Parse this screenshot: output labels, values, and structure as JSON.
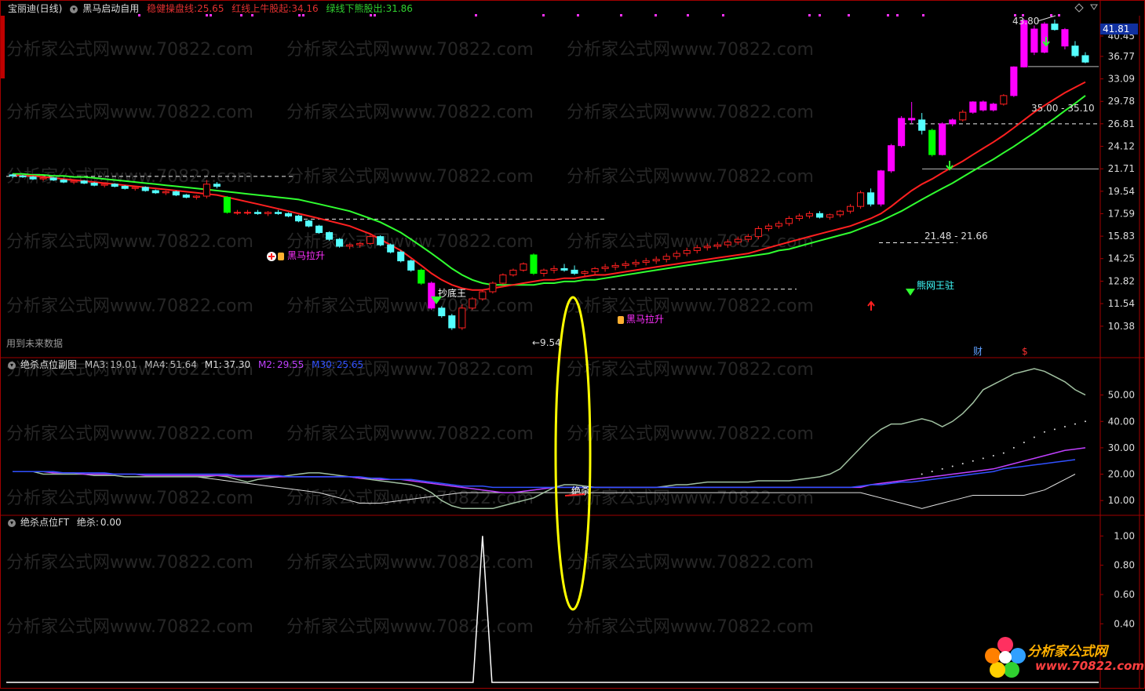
{
  "header_main": {
    "stock": "宝丽迪(日线)",
    "indicator": "黑马启动自用",
    "label_a": "稳健操盘线:",
    "value_a": "25.65",
    "label_b": "红线上牛股起:",
    "value_b": "34.16",
    "label_c": "绿线下熊股出:",
    "value_c": "31.86",
    "color_a": "#e03030",
    "color_b": "#e03030",
    "color_c": "#30d030"
  },
  "header_sub1": {
    "name": "绝杀点位副图",
    "ma3_label": "MA3:",
    "ma3": "19.01",
    "ma4_label": "MA4:",
    "ma4": "51.64",
    "m1_label": "M1:",
    "m1": "37.30",
    "m2_label": "M2:",
    "m2": "29.55",
    "m30_label": "M30:",
    "m30": "25.65"
  },
  "header_sub2": {
    "name": "绝杀点位FT",
    "label": "绝杀:",
    "value": "0.00"
  },
  "annotations": {
    "future_data": "用到未来数据",
    "high_label": "43.80",
    "low_label": "9.54",
    "price_current": "41.81",
    "range_upper": "35.00 - 35.10",
    "range_lower": "21.48 - 21.66",
    "chaodi": "抄底王",
    "heima1": "黑马拉升",
    "heima2": "黑马拉升",
    "wangwang": "熊网王驻",
    "cai": "财",
    "dollar": "$",
    "juesha": "绝杀"
  },
  "watermark": "分析家公式网www.70822.com",
  "logo": {
    "title": "分析家公式网",
    "url": "www.70822.com"
  },
  "axis_main": [
    "40.45",
    "36.77",
    "33.09",
    "29.78",
    "26.81",
    "24.12",
    "21.71",
    "19.54",
    "17.59",
    "15.83",
    "14.25",
    "12.82",
    "11.54",
    "10.38"
  ],
  "axis_sub1": [
    "50.00",
    "40.00",
    "30.00",
    "20.00",
    "10.00"
  ],
  "axis_sub2": [
    "1.00",
    "0.80",
    "0.60",
    "0.40"
  ],
  "chart_data": {
    "type": "candlestick",
    "ylim_main": [
      9.5,
      44.5
    ],
    "candles": [
      [
        21.1,
        21.2,
        20.8,
        21.0
      ],
      [
        21.0,
        21.1,
        20.8,
        20.9
      ],
      [
        20.9,
        21.0,
        20.6,
        20.7
      ],
      [
        20.7,
        20.9,
        20.5,
        20.8
      ],
      [
        20.8,
        20.9,
        20.5,
        20.6
      ],
      [
        20.6,
        20.7,
        20.3,
        20.4
      ],
      [
        20.4,
        20.6,
        20.2,
        20.5
      ],
      [
        20.5,
        20.6,
        20.2,
        20.3
      ],
      [
        20.3,
        20.4,
        20.0,
        20.1
      ],
      [
        20.1,
        20.3,
        19.9,
        20.2
      ],
      [
        20.2,
        20.3,
        19.9,
        20.0
      ],
      [
        20.0,
        20.1,
        19.7,
        19.8
      ],
      [
        19.8,
        20.0,
        19.6,
        19.9
      ],
      [
        19.9,
        20.0,
        19.5,
        19.6
      ],
      [
        19.6,
        19.7,
        19.3,
        19.4
      ],
      [
        19.4,
        19.6,
        19.2,
        19.5
      ],
      [
        19.5,
        19.6,
        19.1,
        19.2
      ],
      [
        19.2,
        19.3,
        18.9,
        19.0
      ],
      [
        19.0,
        19.2,
        18.8,
        19.1
      ],
      [
        19.1,
        20.6,
        18.9,
        20.2
      ],
      [
        20.2,
        20.4,
        19.8,
        20.0
      ],
      [
        19.0,
        19.1,
        17.6,
        17.7
      ],
      [
        17.7,
        17.9,
        17.5,
        17.7
      ],
      [
        17.7,
        17.9,
        17.5,
        17.7
      ],
      [
        17.7,
        17.9,
        17.5,
        17.6
      ],
      [
        17.6,
        17.8,
        17.4,
        17.7
      ],
      [
        17.7,
        17.9,
        17.5,
        17.6
      ],
      [
        17.6,
        17.7,
        17.3,
        17.4
      ],
      [
        17.4,
        17.5,
        16.9,
        17.0
      ],
      [
        17.0,
        17.1,
        16.5,
        16.6
      ],
      [
        16.6,
        16.7,
        16.0,
        16.1
      ],
      [
        16.1,
        16.2,
        15.5,
        15.6
      ],
      [
        15.6,
        15.7,
        15.0,
        15.1
      ],
      [
        15.1,
        15.3,
        14.9,
        15.2
      ],
      [
        15.2,
        15.4,
        15.0,
        15.3
      ],
      [
        15.3,
        15.9,
        15.2,
        15.8
      ],
      [
        15.8,
        15.9,
        15.1,
        15.2
      ],
      [
        15.2,
        15.3,
        14.6,
        14.7
      ],
      [
        14.7,
        14.8,
        14.0,
        14.1
      ],
      [
        14.1,
        14.2,
        13.4,
        13.5
      ],
      [
        13.5,
        13.6,
        12.6,
        12.7
      ],
      [
        12.7,
        12.8,
        11.2,
        11.3
      ],
      [
        11.3,
        11.4,
        10.8,
        10.9
      ],
      [
        10.9,
        11.0,
        10.2,
        10.3
      ],
      [
        10.3,
        11.5,
        10.2,
        11.3
      ],
      [
        11.3,
        11.9,
        11.2,
        11.8
      ],
      [
        11.8,
        12.3,
        11.7,
        12.2
      ],
      [
        12.2,
        12.8,
        12.1,
        12.7
      ],
      [
        12.7,
        13.3,
        12.6,
        13.2
      ],
      [
        13.2,
        13.6,
        13.1,
        13.5
      ],
      [
        13.5,
        14.0,
        13.4,
        13.9
      ],
      [
        14.5,
        14.6,
        13.2,
        13.3
      ],
      [
        13.3,
        13.6,
        13.1,
        13.5
      ],
      [
        13.5,
        13.8,
        13.3,
        13.6
      ],
      [
        13.6,
        13.9,
        13.4,
        13.5
      ],
      [
        13.5,
        13.8,
        13.2,
        13.3
      ],
      [
        13.3,
        13.5,
        13.1,
        13.4
      ],
      [
        13.4,
        13.7,
        13.2,
        13.6
      ],
      [
        13.6,
        13.9,
        13.4,
        13.7
      ],
      [
        13.7,
        14.0,
        13.5,
        13.8
      ],
      [
        13.8,
        14.1,
        13.6,
        13.9
      ],
      [
        13.9,
        14.2,
        13.7,
        14.0
      ],
      [
        14.0,
        14.3,
        13.8,
        14.1
      ],
      [
        14.1,
        14.4,
        13.9,
        14.2
      ],
      [
        14.2,
        14.6,
        14.0,
        14.4
      ],
      [
        14.4,
        14.8,
        14.2,
        14.6
      ],
      [
        14.6,
        15.0,
        14.4,
        14.8
      ],
      [
        14.8,
        15.2,
        14.6,
        15.0
      ],
      [
        15.0,
        15.3,
        14.8,
        15.1
      ],
      [
        15.1,
        15.4,
        14.9,
        15.2
      ],
      [
        15.2,
        15.6,
        15.0,
        15.4
      ],
      [
        15.4,
        15.8,
        15.2,
        15.6
      ],
      [
        15.6,
        16.0,
        15.4,
        15.8
      ],
      [
        15.8,
        16.6,
        15.6,
        16.4
      ],
      [
        16.4,
        16.8,
        16.2,
        16.6
      ],
      [
        16.6,
        17.0,
        16.4,
        16.8
      ],
      [
        16.8,
        17.4,
        16.6,
        17.2
      ],
      [
        17.2,
        17.6,
        17.0,
        17.4
      ],
      [
        17.4,
        17.8,
        17.2,
        17.6
      ],
      [
        17.6,
        17.8,
        17.2,
        17.3
      ],
      [
        17.3,
        17.6,
        17.1,
        17.5
      ],
      [
        17.5,
        17.9,
        17.3,
        17.8
      ],
      [
        17.8,
        18.4,
        17.6,
        18.2
      ],
      [
        18.2,
        19.6,
        18.0,
        19.4
      ],
      [
        19.4,
        19.8,
        18.2,
        18.4
      ],
      [
        18.4,
        21.6,
        18.2,
        21.5
      ],
      [
        21.5,
        24.4,
        21.3,
        24.2
      ],
      [
        24.2,
        27.8,
        24.0,
        27.5
      ],
      [
        27.5,
        29.7,
        26.9,
        27.3
      ],
      [
        27.3,
        28.2,
        25.5,
        26.0
      ],
      [
        26.0,
        26.2,
        23.0,
        23.2
      ],
      [
        23.2,
        27.0,
        23.1,
        26.8
      ],
      [
        26.8,
        27.5,
        26.5,
        27.3
      ],
      [
        27.3,
        28.6,
        27.1,
        28.3
      ],
      [
        28.3,
        29.8,
        28.1,
        29.7
      ],
      [
        29.7,
        29.9,
        28.4,
        28.6
      ],
      [
        28.6,
        29.6,
        28.4,
        29.4
      ],
      [
        29.4,
        30.8,
        29.2,
        30.6
      ],
      [
        30.6,
        35.1,
        30.4,
        35.0
      ],
      [
        35.0,
        43.8,
        34.9,
        43.5
      ],
      [
        41.8,
        42.5,
        37.0,
        37.5
      ],
      [
        37.5,
        43.2,
        37.3,
        42.8
      ],
      [
        42.8,
        43.7,
        41.5,
        41.7
      ],
      [
        41.7,
        42.0,
        38.0,
        38.6
      ],
      [
        38.6,
        39.5,
        36.6,
        36.9
      ],
      [
        36.9,
        37.5,
        35.6,
        35.8
      ]
    ],
    "ma_red": [
      21.1,
      21.0,
      21.0,
      20.9,
      20.8,
      20.7,
      20.6,
      20.5,
      20.4,
      20.3,
      20.2,
      20.1,
      20.0,
      19.9,
      19.8,
      19.7,
      19.6,
      19.5,
      19.4,
      19.3,
      19.2,
      19.0,
      18.8,
      18.6,
      18.4,
      18.2,
      18.0,
      17.8,
      17.6,
      17.4,
      17.2,
      17.0,
      16.8,
      16.6,
      16.3,
      16.0,
      15.6,
      15.2,
      14.8,
      14.3,
      13.8,
      13.3,
      12.9,
      12.6,
      12.4,
      12.3,
      12.3,
      12.4,
      12.5,
      12.6,
      12.7,
      12.8,
      12.9,
      12.9,
      13.0,
      13.0,
      13.1,
      13.2,
      13.2,
      13.3,
      13.4,
      13.5,
      13.6,
      13.7,
      13.8,
      13.9,
      14.0,
      14.1,
      14.2,
      14.3,
      14.4,
      14.5,
      14.6,
      14.8,
      15.0,
      15.2,
      15.4,
      15.6,
      15.8,
      16.0,
      16.2,
      16.4,
      16.6,
      16.9,
      17.2,
      17.6,
      18.2,
      18.9,
      19.6,
      20.2,
      20.7,
      21.3,
      21.9,
      22.5,
      23.2,
      23.9,
      24.6,
      25.4,
      26.3,
      27.3,
      28.3,
      29.2,
      30.1,
      31.0,
      31.8,
      32.6
    ],
    "ma_green": [
      21.2,
      21.2,
      21.1,
      21.1,
      21.0,
      21.0,
      20.9,
      20.9,
      20.8,
      20.7,
      20.6,
      20.5,
      20.4,
      20.3,
      20.2,
      20.1,
      20.0,
      19.9,
      19.8,
      19.7,
      19.6,
      19.5,
      19.4,
      19.3,
      19.2,
      19.1,
      19.0,
      18.9,
      18.8,
      18.6,
      18.4,
      18.2,
      18.0,
      17.8,
      17.5,
      17.2,
      16.9,
      16.5,
      16.1,
      15.6,
      15.1,
      14.6,
      14.1,
      13.6,
      13.2,
      12.9,
      12.7,
      12.6,
      12.6,
      12.6,
      12.6,
      12.6,
      12.7,
      12.7,
      12.8,
      12.8,
      12.9,
      12.9,
      13.0,
      13.1,
      13.2,
      13.3,
      13.4,
      13.5,
      13.6,
      13.7,
      13.8,
      13.9,
      14.0,
      14.1,
      14.2,
      14.3,
      14.4,
      14.5,
      14.6,
      14.8,
      14.9,
      15.1,
      15.3,
      15.5,
      15.7,
      15.9,
      16.1,
      16.4,
      16.7,
      17.0,
      17.4,
      17.8,
      18.3,
      18.8,
      19.3,
      19.8,
      20.3,
      20.9,
      21.5,
      22.1,
      22.7,
      23.4,
      24.1,
      24.9,
      25.7,
      26.6,
      27.5,
      28.5,
      29.5,
      30.6
    ],
    "sub1_ylim": [
      5,
      60
    ],
    "sub1_white": [
      21,
      21,
      21,
      20,
      20,
      20,
      20,
      20,
      19.5,
      19.5,
      19.5,
      19,
      19,
      19,
      19,
      19,
      19,
      19,
      19,
      19,
      19.5,
      19,
      18,
      17,
      18,
      18.5,
      19,
      19.5,
      20,
      20.5,
      20.5,
      20,
      19.5,
      19,
      18.5,
      18,
      17.5,
      17,
      16.5,
      16,
      15,
      13,
      10,
      8,
      7,
      7,
      7,
      7,
      8,
      9,
      10,
      11,
      13,
      15,
      16,
      16,
      15.5,
      15,
      15,
      15,
      15,
      15,
      15,
      15,
      15.5,
      16,
      16,
      16.5,
      17,
      17,
      17,
      17,
      17,
      17.5,
      17.5,
      17.5,
      17.5,
      18,
      18.5,
      19,
      20,
      22,
      26,
      30,
      34,
      37,
      39,
      39,
      40,
      41,
      40,
      38,
      40,
      43,
      47,
      52,
      54,
      56,
      58,
      59,
      60,
      59,
      57,
      55,
      52,
      50
    ],
    "sub1_gray": [
      21,
      21,
      21,
      20,
      20,
      20,
      20,
      20,
      19.5,
      19.5,
      19.5,
      19,
      19,
      19,
      19,
      19,
      19,
      19,
      19,
      18.5,
      18,
      17.5,
      17,
      16.5,
      16,
      15.5,
      15,
      14.5,
      14,
      13.5,
      13,
      12,
      11,
      10,
      9,
      9,
      9,
      9.5,
      10,
      10.5,
      11,
      11.5,
      12,
      12.5,
      13,
      13,
      13,
      13,
      13,
      13,
      13,
      13,
      13,
      13,
      13,
      13,
      13,
      13,
      13,
      13,
      13,
      13,
      13,
      13,
      13,
      13,
      13,
      13,
      13,
      13,
      13,
      13,
      13,
      13,
      13,
      13,
      13,
      13,
      13,
      13,
      13,
      13,
      13,
      13,
      12,
      11,
      10,
      9,
      8,
      7,
      8,
      9,
      10,
      11,
      12,
      12,
      12,
      12,
      12,
      12,
      13,
      14,
      16,
      18,
      20
    ],
    "sub1_purple": [
      21,
      21,
      21,
      21,
      20.5,
      20.5,
      20.5,
      20,
      20,
      20,
      20,
      20,
      20,
      19.5,
      19.5,
      19.5,
      19.5,
      19.5,
      19.5,
      19.5,
      19.5,
      19.5,
      19,
      19,
      19,
      19,
      19,
      19,
      19,
      19,
      19,
      19,
      19,
      19,
      18.5,
      18.5,
      18,
      18,
      18,
      17.5,
      17,
      16.5,
      16,
      15.5,
      15,
      14.5,
      14,
      13.5,
      13,
      13,
      13.5,
      14,
      14.5,
      15,
      15,
      15,
      15,
      15,
      15,
      15,
      15,
      15,
      15,
      15,
      15,
      15,
      15,
      15,
      15,
      15,
      15,
      15,
      15,
      15,
      15,
      15,
      15,
      15,
      15,
      15,
      15,
      15,
      15,
      15,
      16,
      16.5,
      17,
      17.5,
      18,
      18.5,
      19,
      19.5,
      20,
      20.5,
      21,
      21.5,
      22,
      23,
      24,
      25,
      26,
      27,
      28,
      29,
      29.5,
      30
    ],
    "sub1_blue": [
      21,
      21,
      21,
      21,
      21,
      20.5,
      20.5,
      20.5,
      20.5,
      20.5,
      20,
      20,
      20,
      20,
      20,
      20,
      20,
      20,
      20,
      20,
      20,
      20,
      19.5,
      19.5,
      19.5,
      19.5,
      19.5,
      19,
      19,
      19,
      19,
      19,
      19,
      19,
      19,
      18.5,
      18.5,
      18,
      18,
      18,
      17.5,
      17,
      16.5,
      16,
      15.5,
      15.5,
      15.5,
      15,
      15,
      15,
      15,
      15,
      15,
      15,
      15,
      15,
      15,
      15,
      15,
      15,
      15,
      15,
      15,
      15,
      15,
      15,
      15,
      15,
      15,
      15,
      15,
      15,
      15,
      15,
      15,
      15,
      15,
      15,
      15,
      15,
      15,
      15,
      15,
      15.5,
      16,
      16,
      16.5,
      17,
      17,
      17.5,
      18,
      18.5,
      19,
      19.5,
      20,
      20.5,
      21,
      22,
      22.5,
      23,
      23.5,
      24,
      24.5,
      25,
      25.5
    ],
    "sub1_dots": [
      null,
      null,
      null,
      null,
      null,
      null,
      null,
      null,
      null,
      null,
      null,
      null,
      null,
      null,
      null,
      null,
      null,
      null,
      null,
      null,
      null,
      null,
      null,
      null,
      null,
      null,
      null,
      null,
      null,
      null,
      null,
      null,
      null,
      null,
      null,
      null,
      null,
      null,
      null,
      null,
      null,
      null,
      null,
      null,
      null,
      null,
      null,
      null,
      null,
      null,
      null,
      null,
      null,
      null,
      null,
      null,
      null,
      null,
      null,
      null,
      null,
      null,
      null,
      null,
      null,
      null,
      null,
      null,
      null,
      null,
      null,
      null,
      null,
      null,
      null,
      null,
      null,
      null,
      null,
      null,
      null,
      null,
      null,
      null,
      null,
      null,
      null,
      null,
      null,
      20,
      21,
      22,
      23,
      24,
      25,
      26,
      27,
      28,
      30,
      32,
      34,
      36,
      37,
      38,
      39,
      40
    ],
    "sub2_spike_index": 46,
    "sub2_values_note": "单峰 1.00"
  },
  "colors": {
    "up": "#ff2020",
    "down": "#54ffff",
    "magenta": "#ff00ff",
    "green_bar": "#00ff00",
    "red_line": "#ff2020",
    "green_line": "#30ff30",
    "frame": "#a00000",
    "yellow": "#ffff00"
  }
}
